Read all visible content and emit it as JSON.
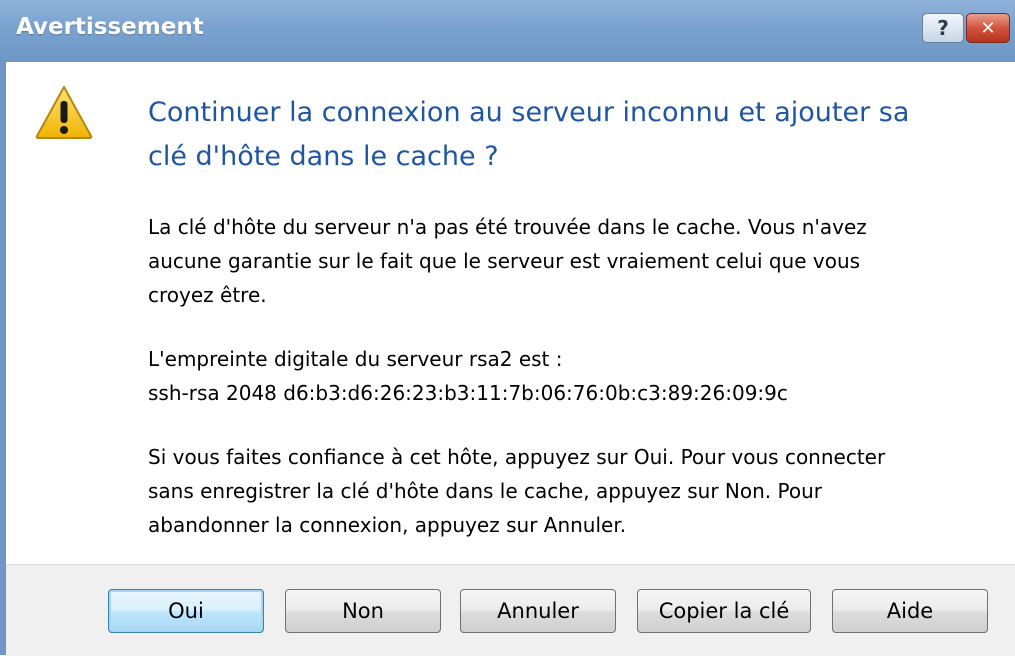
{
  "window": {
    "title": "Avertissement",
    "help_glyph": "?",
    "close_glyph": "✕"
  },
  "message": {
    "heading_lines": [
      "Continuer la connexion au serveur inconnu et ajouter sa",
      "clé d'hôte dans le cache ?"
    ],
    "paragraph1_lines": [
      "La clé d'hôte du serveur n'a pas été trouvée dans le cache. Vous n'avez",
      "aucune garantie sur le fait que le serveur est vraiement celui que vous",
      "croyez être."
    ],
    "paragraph2_lines": [
      "L'empreinte digitale du serveur rsa2 est :",
      "ssh-rsa 2048 d6:b3:d6:26:23:b3:11:7b:06:76:0b:c3:89:26:09:9c"
    ],
    "paragraph3_lines": [
      "Si vous faites confiance à cet hôte, appuyez sur Oui. Pour vous connecter",
      "sans enregistrer la clé d'hôte dans le cache, appuyez sur Non. Pour",
      "abandonner la connexion, appuyez sur Annuler."
    ]
  },
  "buttons": {
    "yes": "Oui",
    "no": "Non",
    "cancel": "Annuler",
    "copy_key": "Copier la clé",
    "help": "Aide"
  },
  "colors": {
    "titlebar": "#7aa2cf",
    "heading": "#1f55a3",
    "warning_fill": "#f5c518",
    "close_button": "#d2533b"
  },
  "icons": {
    "warning": "warning-icon",
    "help": "help-icon",
    "close": "close-icon"
  }
}
